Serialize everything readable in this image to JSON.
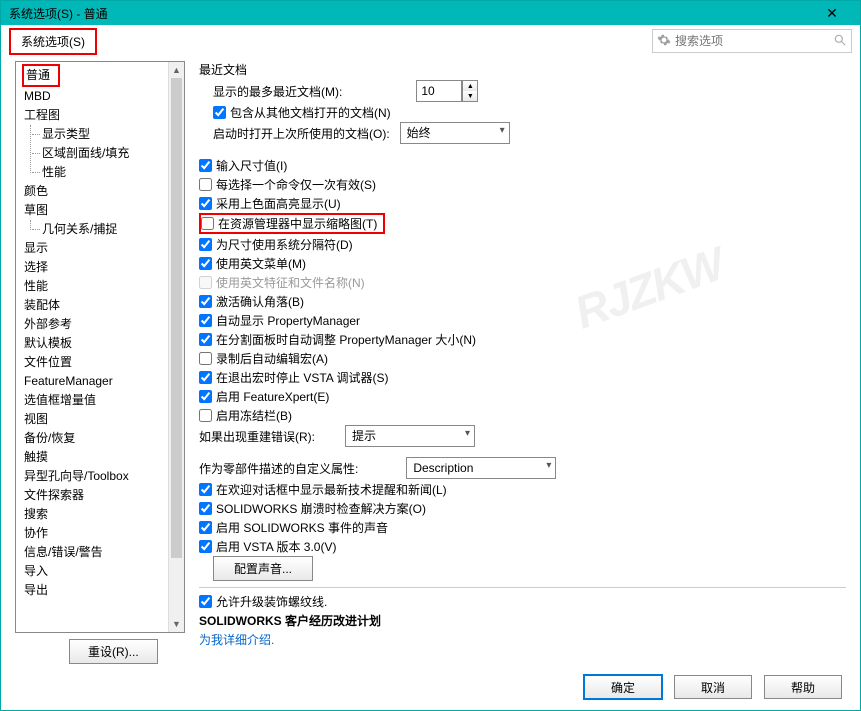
{
  "window": {
    "title": "系统选项(S) - 普通"
  },
  "topbar": {
    "tab": "系统选项(S)",
    "search_placeholder": "搜索选项"
  },
  "sidebar": {
    "items": [
      "普通",
      "MBD",
      "工程图",
      "颜色",
      "草图",
      "显示",
      "选择",
      "性能",
      "装配体",
      "外部参考",
      "默认模板",
      "文件位置",
      "FeatureManager",
      "选值框增量值",
      "视图",
      "备份/恢复",
      "触摸",
      "异型孔向导/Toolbox",
      "文件探索器",
      "搜索",
      "协作",
      "信息/错误/警告",
      "导入",
      "导出"
    ],
    "drawing_sub": [
      "显示类型",
      "区域剖面线/填充",
      "性能"
    ],
    "sketch_sub": [
      "几何关系/捕捉"
    ],
    "reset": "重设(R)..."
  },
  "main": {
    "recent": {
      "title": "最近文档",
      "max_label": "显示的最多最近文档(M):",
      "max_value": "10",
      "include_other": "包含从其他文档打开的文档(N)",
      "startup_label": "启动时打开上次所使用的文档(O):",
      "startup_value": "始终"
    },
    "cbs": {
      "c1": "输入尺寸值(I)",
      "c2": "每选择一个命令仅一次有效(S)",
      "c3": "采用上色面高亮显示(U)",
      "c4": "在资源管理器中显示缩略图(T)",
      "c5": "为尺寸使用系统分隔符(D)",
      "c6": "使用英文菜单(M)",
      "c7": "使用英文特征和文件名称(N)",
      "c8": "激活确认角落(B)",
      "c9": "自动显示 PropertyManager",
      "c10": "在分割面板时自动调整 PropertyManager 大小(N)",
      "c11": "录制后自动编辑宏(A)",
      "c12": "在退出宏时停止 VSTA 调试器(S)",
      "c13": "启用 FeatureXpert(E)",
      "c14": "启用冻结栏(B)",
      "rebuild_label": "如果出现重建错误(R):",
      "rebuild_value": "提示",
      "custom_prop_label": "作为零部件描述的自定义属性:",
      "custom_prop_value": "Description",
      "c15": "在欢迎对话框中显示最新技术提醒和新闻(L)",
      "c16": "SOLIDWORKS 崩溃时检查解决方案(O)",
      "c17": "启用 SOLIDWORKS 事件的声音",
      "c18": "启用 VSTA 版本 3.0(V)",
      "sound_btn": "配置声音...",
      "c19": "允许升级装饰螺纹线.",
      "program_title": "SOLIDWORKS 客户经历改进计划",
      "program_link": "为我详细介绍."
    }
  },
  "footer": {
    "ok": "确定",
    "cancel": "取消",
    "help": "帮助"
  },
  "watermark": "RJZKW"
}
